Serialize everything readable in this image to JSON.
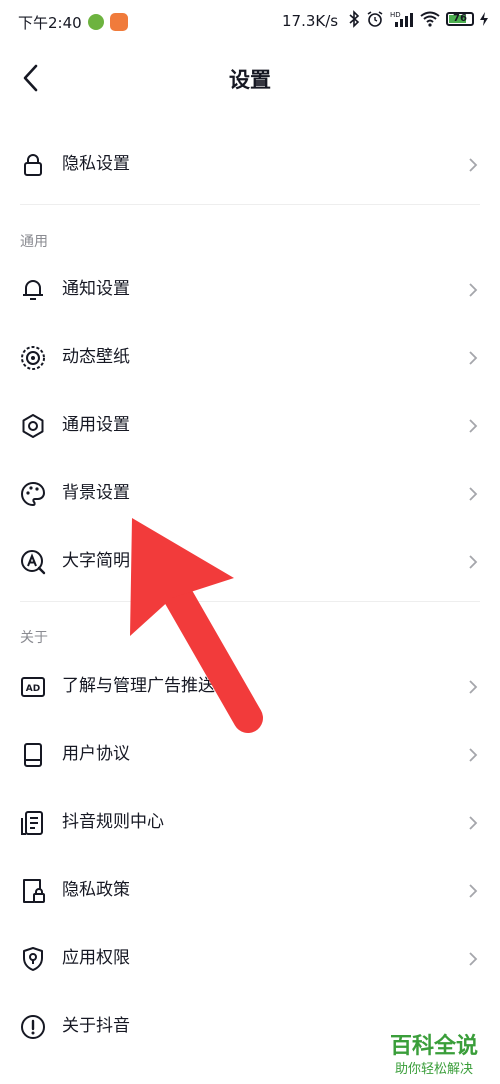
{
  "status": {
    "time": "下午2:40",
    "net_speed": "17.3K/s",
    "hd": "HD",
    "battery": "76",
    "battery_level": 0.76
  },
  "header": {
    "title": "设置"
  },
  "privacy": {
    "label": "隐私设置"
  },
  "general": {
    "section": "通用",
    "items": [
      {
        "label": "通知设置"
      },
      {
        "label": "动态壁纸"
      },
      {
        "label": "通用设置"
      },
      {
        "label": "背景设置"
      },
      {
        "label": "大字简明"
      }
    ]
  },
  "about": {
    "section": "关于",
    "items": [
      {
        "label": "了解与管理广告推送"
      },
      {
        "label": "用户协议"
      },
      {
        "label": "抖音规则中心"
      },
      {
        "label": "隐私政策"
      },
      {
        "label": "应用权限"
      },
      {
        "label": "关于抖音"
      }
    ]
  },
  "watermark": {
    "title": "百科全说",
    "subtitle": "助你轻松解决"
  },
  "colors": {
    "arrow": "#f23b3b",
    "text": "#161823",
    "muted": "#8a8b91",
    "watermark": "#3a9e3a"
  }
}
